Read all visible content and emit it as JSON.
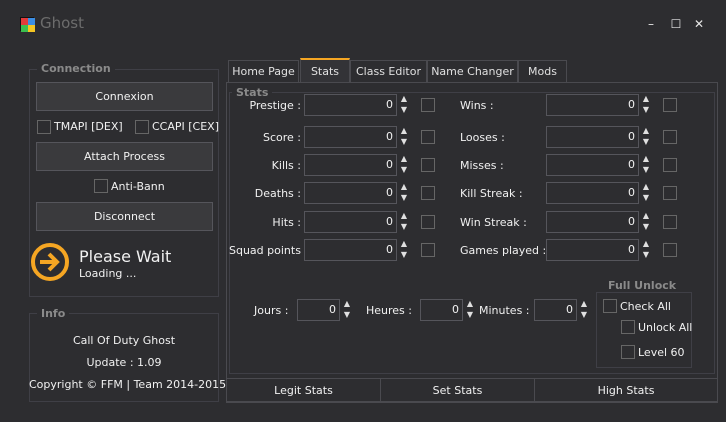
{
  "window": {
    "title": "Ghost",
    "minimize": "–",
    "maximize": "☐",
    "close": "✕"
  },
  "connection": {
    "group_title": "Connection",
    "connect_label": "Connexion",
    "tmapi_label": "TMAPI [DEX]",
    "ccapi_label": "CCAPI [CEX]",
    "attach_label": "Attach Process",
    "antiban_label": "Anti-Bann",
    "disconnect_label": "Disconnect",
    "status_title": "Please Wait",
    "status_sub": "Loading ..."
  },
  "info": {
    "group_title": "Info",
    "line1": "Call Of Duty Ghost",
    "line2": "Update : 1.09",
    "line3": "Copyright © FFM | Team 2014-2015"
  },
  "tabs": [
    "Home Page",
    "Stats",
    "Class Editor",
    "Name Changer",
    "Mods"
  ],
  "stats": {
    "group_title": "Stats",
    "left": [
      {
        "label": "Prestige :",
        "value": "0"
      },
      {
        "label": "Score :",
        "value": "0"
      },
      {
        "label": "Kills :",
        "value": "0"
      },
      {
        "label": "Deaths :",
        "value": "0"
      },
      {
        "label": "Hits :",
        "value": "0"
      },
      {
        "label": "Squad points :",
        "value": "0"
      }
    ],
    "right": [
      {
        "label": "Wins :",
        "value": "0"
      },
      {
        "label": "Looses :",
        "value": "0"
      },
      {
        "label": "Misses :",
        "value": "0"
      },
      {
        "label": "Kill Streak :",
        "value": "0"
      },
      {
        "label": "Win Streak :",
        "value": "0"
      },
      {
        "label": "Games played :",
        "value": "0"
      }
    ],
    "time": [
      {
        "label": "Jours :",
        "value": "0"
      },
      {
        "label": "Heures :",
        "value": "0"
      },
      {
        "label": "Minutes :",
        "value": "0"
      }
    ],
    "full_unlock": {
      "title": "Full Unlock",
      "check_all": "Check All",
      "unlock_all": "Unlock All",
      "level60": "Level 60"
    },
    "buttons": {
      "legit": "Legit Stats",
      "set": "Set Stats",
      "high": "High Stats"
    }
  },
  "colors": {
    "accent": "#f5a623",
    "background": "#2d2d30"
  },
  "icons": {
    "status": "arrow-circle-icon",
    "app": "app-grid-icon"
  }
}
